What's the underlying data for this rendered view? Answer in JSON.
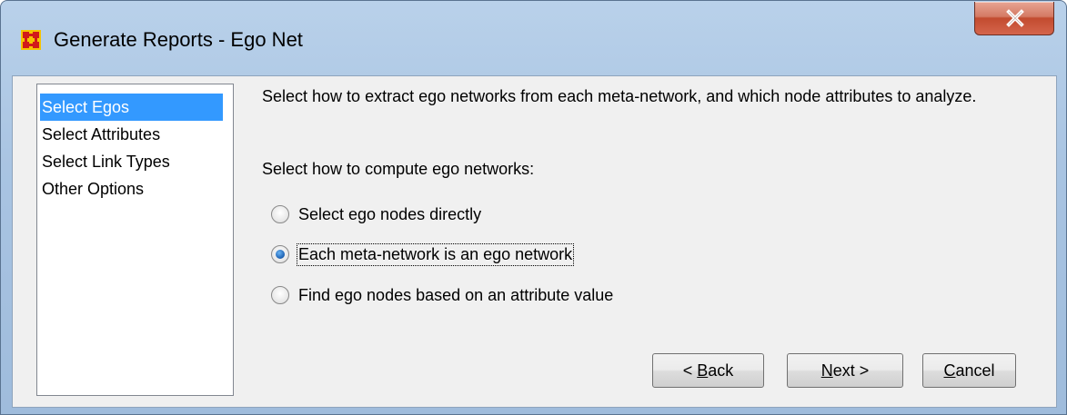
{
  "window": {
    "title": "Generate Reports - Ego Net"
  },
  "sidebar": {
    "items": [
      {
        "label": "Select Egos",
        "selected": true
      },
      {
        "label": "Select Attributes",
        "selected": false
      },
      {
        "label": "Select Link Types",
        "selected": false
      },
      {
        "label": "Other Options",
        "selected": false
      }
    ]
  },
  "main": {
    "description": "Select how to extract ego networks from each meta-network, and which node attributes to analyze.",
    "section_label": "Select how to compute ego networks:",
    "options": [
      {
        "label": "Select ego nodes directly",
        "checked": false
      },
      {
        "label": "Each meta-network is an ego network",
        "checked": true
      },
      {
        "label": "Find ego nodes based on an attribute value",
        "checked": false
      }
    ]
  },
  "buttons": {
    "back": {
      "prefix": "< ",
      "mnemonic": "B",
      "rest": "ack"
    },
    "next": {
      "prefix": "",
      "mnemonic": "N",
      "rest": "ext >"
    },
    "cancel": {
      "prefix": "",
      "mnemonic": "C",
      "rest": "ancel"
    }
  },
  "colors": {
    "selection": "#3399ff",
    "close_button": "#c24b2f",
    "titlebar": "#b9d1ea"
  },
  "icons": {
    "app": "network-grid-icon",
    "close": "close-icon"
  }
}
